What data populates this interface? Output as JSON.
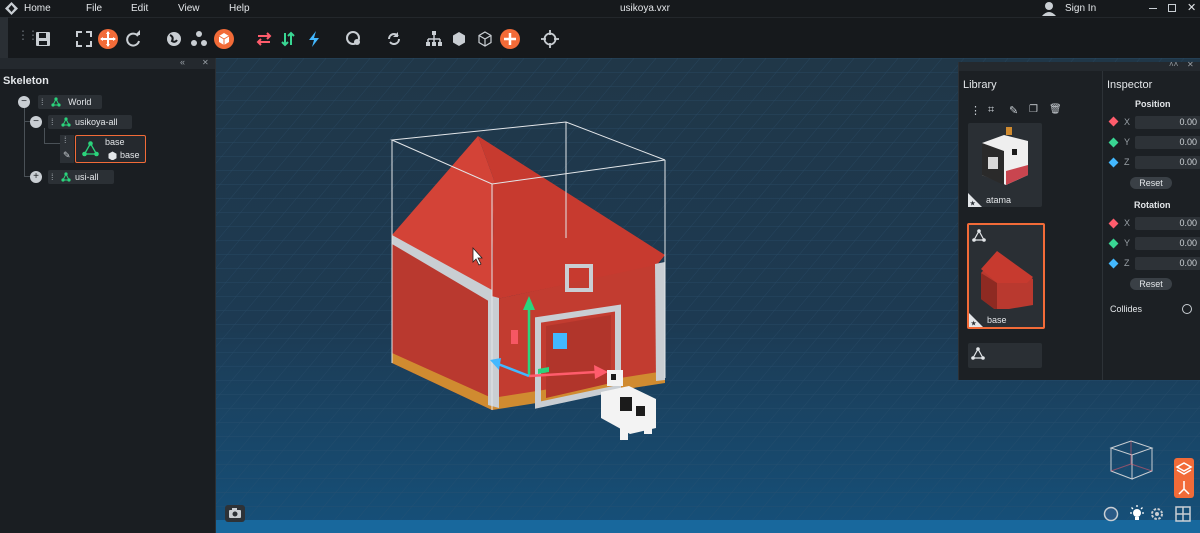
{
  "titlebar": {
    "home_label": "Home",
    "menus": [
      "File",
      "Edit",
      "View",
      "Help"
    ],
    "filename": "usikoya.vxr",
    "signin_label": "Sign In"
  },
  "toolbar": {
    "icons": [
      "save-icon",
      "frame-icon",
      "move-icon",
      "rotate-icon",
      "world-icon",
      "cluster-icon",
      "cube-orange-icon",
      "swap-h-icon",
      "swap-v-icon",
      "lightning-icon",
      "search-globe-icon",
      "loop-icon",
      "tree-icon",
      "cube-solid-icon",
      "cube-wire-icon",
      "add-icon",
      "target-icon"
    ]
  },
  "skeleton": {
    "title": "Skeleton",
    "nodes": [
      {
        "label": "World",
        "toggle": "−"
      },
      {
        "label": "usikoya-all",
        "toggle": "−"
      },
      {
        "label": "base",
        "sub_label": "base"
      },
      {
        "label": "usi-all",
        "toggle": "+"
      }
    ]
  },
  "library": {
    "title": "Library",
    "items": [
      {
        "label": "atama"
      },
      {
        "label": "base"
      },
      {
        "label": ""
      }
    ]
  },
  "inspector": {
    "title": "Inspector",
    "position_label": "Position",
    "rotation_label": "Rotation",
    "axes": [
      "X",
      "Y",
      "Z"
    ],
    "position": [
      "0.00",
      "0.00",
      "0.00"
    ],
    "rotation": [
      "0.00",
      "0.00",
      "0.00"
    ],
    "reset_label": "Reset",
    "collides_label": "Collides"
  },
  "colors": {
    "accent": "#f26b38",
    "green": "#2bd47c",
    "x_axis": "#ff5c6c",
    "y_axis": "#39d693",
    "z_axis": "#43b8ff"
  }
}
